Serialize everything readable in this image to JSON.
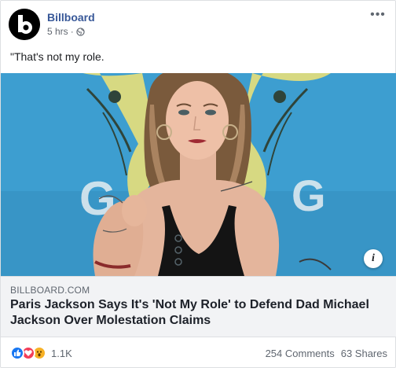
{
  "post": {
    "page_name": "Billboard",
    "timestamp": "5 hrs",
    "separator": "·",
    "text": "\"That's not my role."
  },
  "link": {
    "domain": "BILLBOARD.COM",
    "title": "Paris Jackson Says It's 'Not My Role' to Defend Dad Michael Jackson Over Molestation Claims"
  },
  "footer": {
    "reaction_count": "1.1K",
    "comments": "254 Comments",
    "shares": "63 Shares"
  },
  "icons": {
    "avatar": "billboard-logo-icon",
    "privacy": "globe-icon",
    "menu": "more-options-icon",
    "info": "info-icon",
    "reactions": [
      "like-icon",
      "love-icon",
      "wow-icon"
    ]
  },
  "colors": {
    "page_name": "#385898",
    "link_box_bg": "#f2f3f5",
    "like": "#1877f2",
    "love": "#f33e58",
    "wow": "#f7b125",
    "image_bg": "#3d9ed0"
  }
}
